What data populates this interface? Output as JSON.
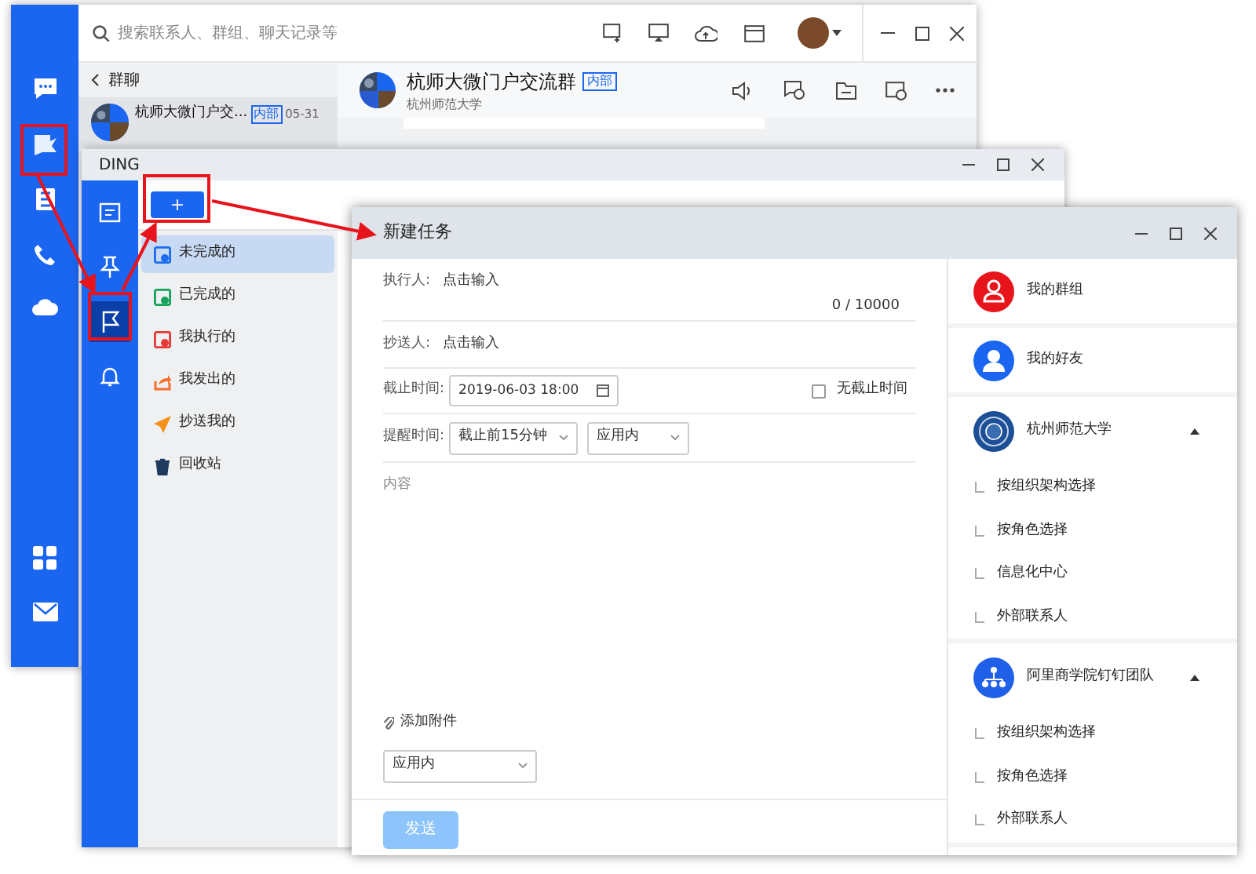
{
  "main_window": {
    "search": {
      "placeholder": "搜索联系人、群组、聊天记录等"
    },
    "chat_list": {
      "header": "群聊",
      "items": [
        {
          "name": "杭师大微门户交...",
          "badge": "内部",
          "time": "05-31",
          "selected": true
        }
      ]
    },
    "chat": {
      "title": "杭师大微门户交流群",
      "badge": "内部",
      "subtitle": "杭州师范大学"
    }
  },
  "ding_window": {
    "title": "DING",
    "add_button": "+",
    "sidebar": [
      {
        "kind": "calendar",
        "selected": false
      },
      {
        "kind": "pin",
        "selected": false
      },
      {
        "kind": "flag",
        "selected": true
      },
      {
        "kind": "bell",
        "selected": false
      }
    ],
    "items": [
      {
        "label": "未完成的",
        "kind": "doc",
        "color": "#1a6cf0",
        "selected": true
      },
      {
        "label": "已完成的",
        "kind": "doc",
        "color": "#16a35a",
        "selected": false
      },
      {
        "label": "我执行的",
        "kind": "doc",
        "color": "#e53935",
        "selected": false
      },
      {
        "label": "我发出的",
        "kind": "share",
        "color": "#f5702a",
        "selected": false
      },
      {
        "label": "抄送我的",
        "kind": "send",
        "color": "#f5901a",
        "selected": false
      },
      {
        "label": "回收站",
        "kind": "trash",
        "color": "#1f3a5f",
        "selected": false
      }
    ]
  },
  "task_window": {
    "title": "新建任务",
    "assignee": {
      "label": "执行人:",
      "placeholder": "点击输入"
    },
    "counter": "0 / 10000",
    "cc": {
      "label": "抄送人:",
      "placeholder": "点击输入"
    },
    "deadline": {
      "label": "截止时间:",
      "value": "2019-06-03 18:00",
      "no_deadline": {
        "label": "无截止时间",
        "checked": false
      }
    },
    "reminder": {
      "label": "提醒时间:",
      "when": "截止前15分钟",
      "channel": "应用内"
    },
    "content": {
      "placeholder": "内容"
    },
    "attach": "添加附件",
    "send_channel": "应用内",
    "send_button": {
      "label": "发送",
      "disabled": true
    },
    "contacts": [
      {
        "kind": "groups",
        "label": "我的群组"
      },
      {
        "kind": "friends",
        "label": "我的好友"
      }
    ],
    "organizations": [
      {
        "kind": "emblem",
        "name": "杭州师范大学",
        "expanded": true,
        "children": [
          {
            "label": "按组织架构选择"
          },
          {
            "label": "按角色选择"
          },
          {
            "label": "信息化中心"
          },
          {
            "label": "外部联系人"
          }
        ]
      },
      {
        "kind": "org-chart",
        "name": "阿里商学院钉钉团队",
        "expanded": true,
        "children": [
          {
            "label": "按组织架构选择"
          },
          {
            "label": "按角色选择"
          },
          {
            "label": "外部联系人"
          }
        ]
      }
    ]
  }
}
